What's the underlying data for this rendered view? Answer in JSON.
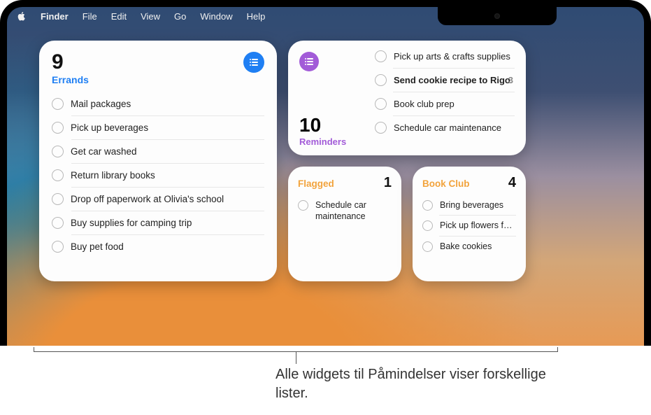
{
  "menubar": {
    "app": "Finder",
    "items": [
      "File",
      "Edit",
      "View",
      "Go",
      "Window",
      "Help"
    ]
  },
  "widgets": {
    "errands": {
      "count": "9",
      "title": "Errands",
      "color": "#1f7ff3",
      "items": [
        "Mail packages",
        "Pick up beverages",
        "Get car washed",
        "Return library books",
        "Drop off paperwork at Olivia's school",
        "Buy supplies for camping trip",
        "Buy pet food"
      ]
    },
    "reminders": {
      "count": "10",
      "title": "Reminders",
      "color": "#a25bd8",
      "items": [
        {
          "text": "Pick up arts & crafts supplies",
          "bold": false,
          "badge": ""
        },
        {
          "text": "Send cookie recipe to Rigo",
          "bold": true,
          "badge": "3"
        },
        {
          "text": "Book club prep",
          "bold": false,
          "badge": ""
        },
        {
          "text": "Schedule car maintenance",
          "bold": false,
          "badge": ""
        }
      ]
    },
    "flagged": {
      "title": "Flagged",
      "count": "1",
      "color": "#f2a33c",
      "items": [
        "Schedule car maintenance"
      ]
    },
    "bookclub": {
      "title": "Book Club",
      "count": "4",
      "color": "#f2a33c",
      "items": [
        "Bring beverages",
        "Pick up flowers f…",
        "Bake cookies"
      ]
    }
  },
  "caption": "Alle widgets til Påmindelser viser forskellige lister."
}
